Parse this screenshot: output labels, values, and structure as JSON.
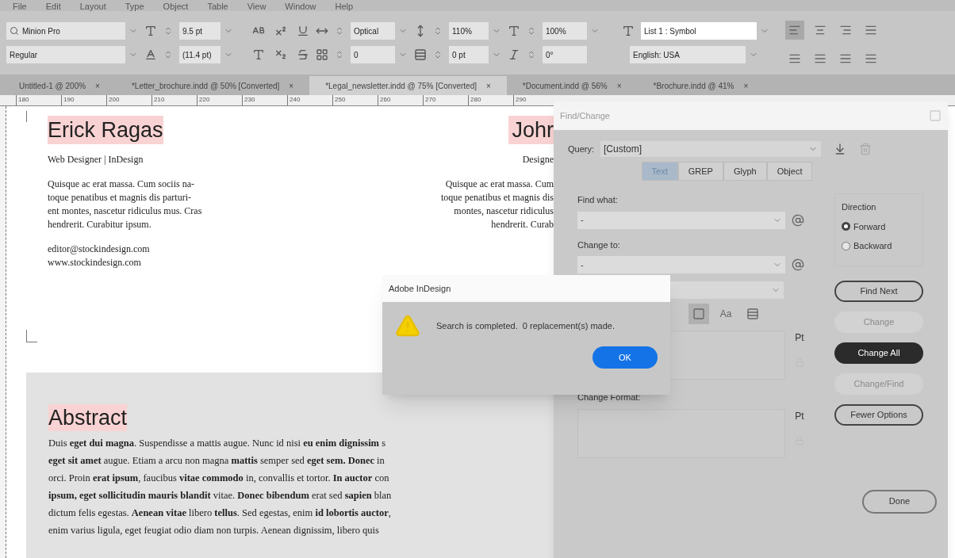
{
  "menu_bar": {
    "items": [
      "File",
      "Edit",
      "Layout",
      "Type",
      "Object",
      "Table",
      "View",
      "Window",
      "Help"
    ]
  },
  "control_panel": {
    "font_family": "Minion Pro",
    "font_style": "Regular",
    "font_size": "9.5 pt",
    "leading": "(11.4 pt)",
    "kerning": "Optical",
    "tracking": "0",
    "vertical_scale": "110%",
    "baseline_shift": "0 pt",
    "horizontal_scale": "100%",
    "skew": "0°",
    "character_style": "List 1 : Symbol",
    "language": "English: USA",
    "align_buttons": [
      {
        "selected": true
      },
      {
        "selected": false
      },
      {
        "selected": false
      },
      {
        "selected": false
      },
      {
        "selected": false
      },
      {
        "selected": false
      },
      {
        "selected": false
      },
      {
        "selected": false
      }
    ]
  },
  "document_tabs": [
    {
      "label": "Untitled-1 @ 200%",
      "close": "×",
      "selected": false
    },
    {
      "label": "*Letter_brochure.indd @ 50% [Converted]",
      "close": "×",
      "selected": false
    },
    {
      "label": "*Legal_newsletter.indd @ 75% [Converted]",
      "close": "×",
      "selected": true
    },
    {
      "label": "*Document.indd @ 56%",
      "close": "×",
      "selected": false
    },
    {
      "label": "*Brochure.indd @ 41%",
      "close": "×",
      "selected": false
    }
  ],
  "ruler": {
    "labels": [
      "180",
      "190",
      "200",
      "210",
      "220",
      "230",
      "240",
      "250",
      "260",
      "270",
      "280",
      "290"
    ]
  },
  "page": {
    "left_profile": {
      "name": "Erick Ragas",
      "role": "Web Designer | InDesign",
      "bio": [
        "Quisque ac erat massa. Cum sociis na-",
        "toque penatibus et magnis dis parturi-",
        "ent montes, nascetur ridiculus mus. Cras",
        "hendrerit. Curabitur ipsum."
      ],
      "email": "editor@stockindesign.com",
      "website": "www.stockindesign.com"
    },
    "right_profile": {
      "name": "Johr",
      "role": "Designe",
      "bio": [
        "Quisque ac erat massa. Cum",
        "toque penatibus et magnis dis",
        "montes, nascetur ridiculus",
        "hendrerit. Curab"
      ]
    },
    "abstract": {
      "heading": "Abstract",
      "lines": [
        "Duis **eget dui magna**. Suspendisse a mattis augue. Nunc id nisi **eu enim dignissim** s",
        "**eget sit amet** augue. Etiam a arcu non magna **mattis** semper sed **eget sem. Donec** in",
        "orci. Proin **erat ipsum**, faucibus **vitae commodo** in, convallis et tortor. **In auctor** con",
        "**ipsum, eget sollicitudin mauris blandit** vitae. **Donec bibendum** erat sed **sapien** blan",
        "dictum felis egestas. **Aenean vitae** libero **tellus**. Sed egestas, enim **id lobortis auctor**,",
        "enim varius ligula, eget feugiat odio diam non turpis. Aenean dignissim, libero quis"
      ]
    }
  },
  "find_change_dialog": {
    "title": "Find/Change",
    "query_label": "Query:",
    "query_value": "[Custom]",
    "tabs": [
      {
        "label": "Text",
        "selected": true
      },
      {
        "label": "GREP",
        "selected": false
      },
      {
        "label": "Glyph",
        "selected": false
      },
      {
        "label": "Object",
        "selected": false
      }
    ],
    "find_what_label": "Find what:",
    "find_what_value": "-",
    "change_to_label": "Change to:",
    "change_to_value": "-",
    "options": [
      {
        "kind": "master",
        "selected": true
      },
      {
        "kind": "case",
        "label": "Aa",
        "selected": false
      },
      {
        "kind": "whole_word",
        "selected": false
      }
    ],
    "direction": {
      "title": "Direction",
      "options": [
        {
          "label": "Forward",
          "selected": true
        },
        {
          "label": "Backward",
          "selected": false
        }
      ]
    },
    "buttons": [
      {
        "label": "Find Next",
        "kind": "outline",
        "disabled": false
      },
      {
        "label": "Change",
        "kind": "outline",
        "disabled": true
      },
      {
        "label": "Change All",
        "kind": "primary",
        "disabled": false
      },
      {
        "label": "Change/Find",
        "kind": "outline",
        "disabled": true
      },
      {
        "label": "Fewer Options",
        "kind": "outline",
        "disabled": false
      }
    ],
    "find_format_unit": "Pt",
    "change_format_label": "Change Format:",
    "change_format_unit": "Pt",
    "done_button": "Done"
  },
  "alert": {
    "title": "Adobe InDesign",
    "message": "Search is completed.  0 replacement(s) made.",
    "ok_button": "OK"
  }
}
